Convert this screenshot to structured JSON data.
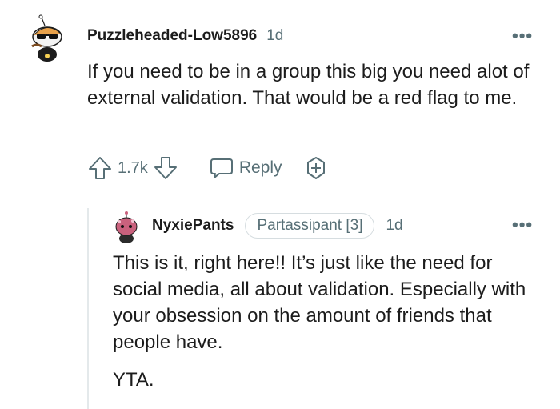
{
  "comment": {
    "author": "Puzzleheaded-Low5896",
    "time": "1d",
    "more_icon": "more-horizontal-icon",
    "text": "If you need to be in a group this big you need alot of external validation. That would be a red flag to me.",
    "votes": "1.7k",
    "reply_label": "Reply",
    "icons": {
      "upvote": "upvote-arrow-icon",
      "downvote": "downvote-arrow-icon",
      "reply": "speech-bubble-icon",
      "award": "award-plus-icon"
    }
  },
  "reply": {
    "author": "NyxiePants",
    "flair": "Partassipant [3]",
    "time": "1d",
    "more_icon": "more-horizontal-icon",
    "paragraphs": [
      "This is it, right here!! It’s just like the need for social media, all about validation. Especially with your obsession on the amount of friends that people have.",
      "YTA."
    ]
  },
  "colors": {
    "text": "#1c1c1c",
    "meta": "#576f76",
    "thread_line": "#e4e9eb"
  }
}
